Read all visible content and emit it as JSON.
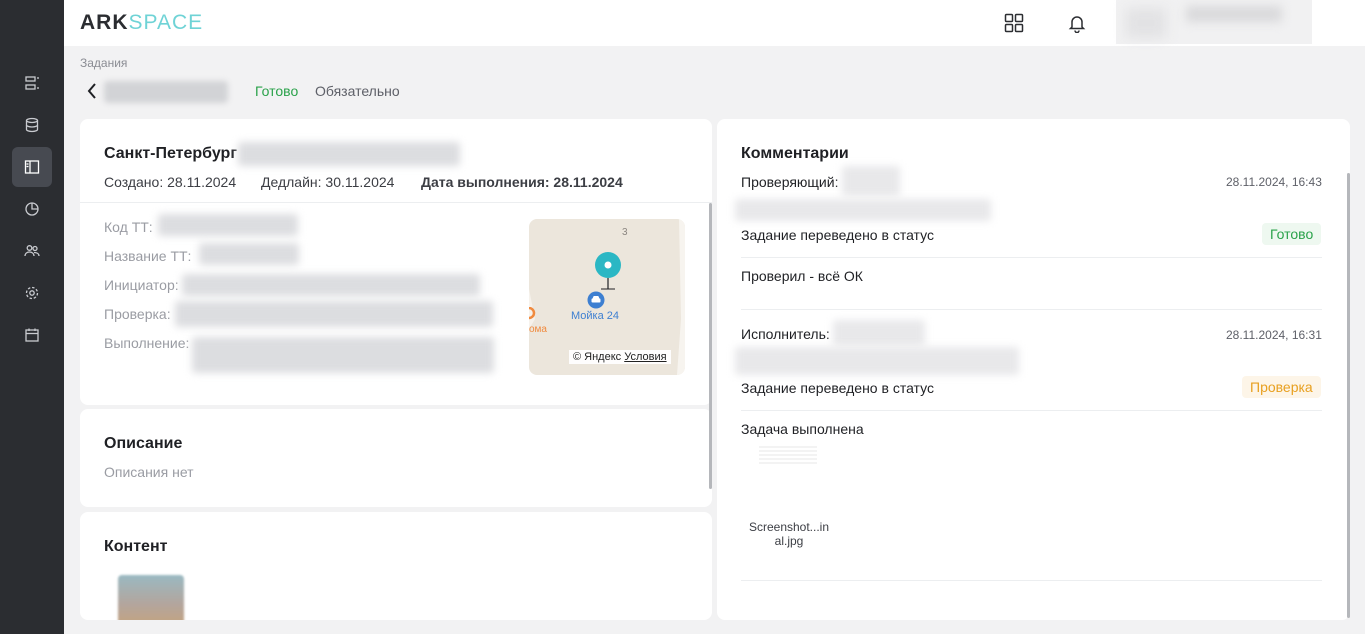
{
  "app": {
    "logo_dark": "ARK",
    "logo_light": "SPACE"
  },
  "sidebar": {
    "items": [
      {
        "icon": "list-icon",
        "active": false
      },
      {
        "icon": "database-icon",
        "active": false
      },
      {
        "icon": "panel-icon",
        "active": true
      },
      {
        "icon": "pie-chart-icon",
        "active": false
      },
      {
        "icon": "users-icon",
        "active": false
      },
      {
        "icon": "gear-icon",
        "active": false
      },
      {
        "icon": "calendar-icon",
        "active": false
      }
    ]
  },
  "breadcrumb": "Задания",
  "task": {
    "status_done": "Готово",
    "status_required": "Обязательно",
    "city": "Санкт-Петербург",
    "created": "Создано: 28.11.2024",
    "deadline": "Дедлайн: 30.11.2024",
    "completion_label": "Дата выполнения: 28.11.2024",
    "fields": {
      "code": "Код ТТ:",
      "name": "Название ТТ:",
      "initiator": "Инициатор:",
      "check": "Проверка:",
      "execution": "Выполнение:"
    },
    "map": {
      "place": "Мойка 24",
      "house_number": "3",
      "partial_label": "ома",
      "copyright": "© Яндекс",
      "terms": "Условия"
    }
  },
  "description": {
    "title": "Описание",
    "empty": "Описания нет"
  },
  "content": {
    "title": "Контент"
  },
  "comments": {
    "title": "Комментарии",
    "items": [
      {
        "role": "Проверяющий:",
        "time": "28.11.2024, 16:43",
        "status_text": "Задание переведено в статус",
        "status": "Готово",
        "message": "Проверил - всё ОК"
      },
      {
        "role": "Исполнитель:",
        "time": "28.11.2024, 16:31",
        "status_text": "Задание переведено в статус",
        "status": "Проверка",
        "message": "Задача выполнена",
        "file_name": "Screenshot...in al.jpg"
      }
    ]
  },
  "colors": {
    "sidebar_bg": "#2b2d31",
    "accent": "#6fd3d6",
    "status_done": "#2aa24a",
    "status_check": "#e8a020",
    "map_pin": "#2bb7c4"
  }
}
